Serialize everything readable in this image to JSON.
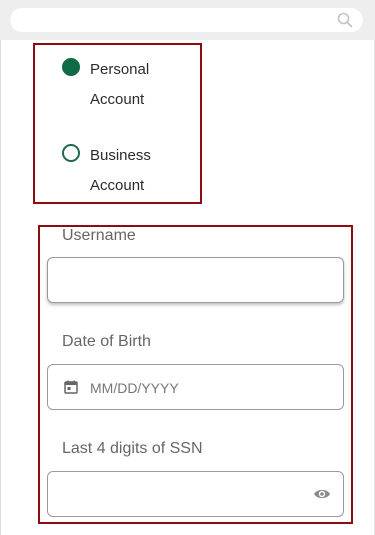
{
  "search": {
    "placeholder": "",
    "icon": "search-icon"
  },
  "account_type": {
    "options": [
      {
        "line1": "Personal",
        "line2": "Account",
        "selected": true
      },
      {
        "line1": "Business",
        "line2": "Account",
        "selected": false
      }
    ],
    "accent_color": "#0f6b46"
  },
  "form": {
    "username": {
      "label": "Username",
      "value": ""
    },
    "dob": {
      "label": "Date of Birth",
      "placeholder": "MM/DD/YYYY",
      "icon": "calendar-icon"
    },
    "ssn": {
      "label": "Last 4 digits of SSN",
      "value": "",
      "icon": "eye-icon"
    }
  },
  "highlight_color": "#8b0d12"
}
